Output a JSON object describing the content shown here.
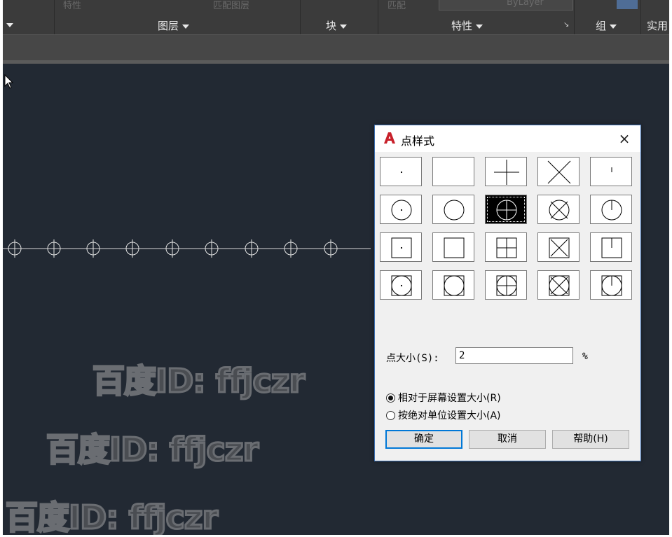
{
  "ribbon": {
    "faded_texts": [
      "特性",
      "匹配图层",
      "匹配",
      "ByLayer"
    ],
    "panels": [
      {
        "label": ""
      },
      {
        "label": "图层"
      },
      {
        "label": "块"
      },
      {
        "label": "特性"
      },
      {
        "label": "组"
      },
      {
        "label": "实用"
      }
    ]
  },
  "watermarks": [
    "百度ID: ffjczr",
    "百度ID: ffjczr",
    "百度ID: ffjczr"
  ],
  "dialog": {
    "title": "点样式",
    "close_glyph": "×",
    "point_styles": [
      {
        "name": "dot"
      },
      {
        "name": "none"
      },
      {
        "name": "plus"
      },
      {
        "name": "cross"
      },
      {
        "name": "tick"
      },
      {
        "name": "circle-dot"
      },
      {
        "name": "circle"
      },
      {
        "name": "circle-plus"
      },
      {
        "name": "circle-cross"
      },
      {
        "name": "circle-tick"
      },
      {
        "name": "square-dot"
      },
      {
        "name": "square"
      },
      {
        "name": "square-plus"
      },
      {
        "name": "square-cross"
      },
      {
        "name": "square-tick"
      },
      {
        "name": "square-circle-dot"
      },
      {
        "name": "square-circle"
      },
      {
        "name": "square-circle-plus"
      },
      {
        "name": "square-circle-cross"
      },
      {
        "name": "square-circle-tick"
      }
    ],
    "selected_style": "circle-plus",
    "size_label": "点大小(S):",
    "size_value": "2",
    "size_unit": "%",
    "radio_relative": "相对于屏幕设置大小(R)",
    "radio_absolute": "按绝对单位设置大小(A)",
    "selected_radio": "relative",
    "ok_label": "确定",
    "cancel_label": "取消",
    "help_label": "帮助(H)"
  },
  "colors": {
    "canvas_bg": "#222933",
    "ribbon_bg": "#3b3b3b",
    "dialog_border": "#3c6fb3",
    "autocad_red": "#c8202a"
  }
}
